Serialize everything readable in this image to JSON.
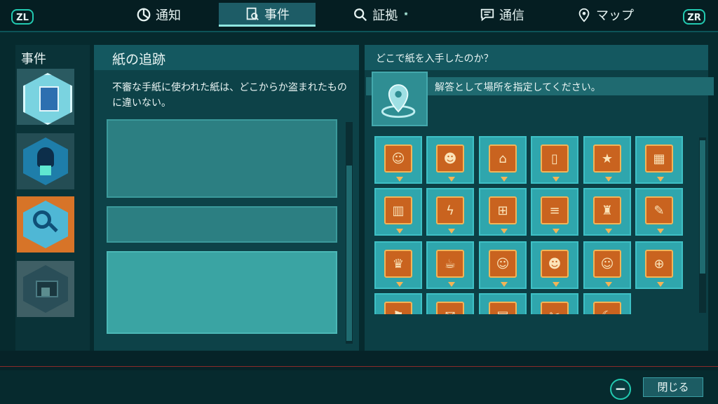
{
  "topbar": {
    "left_shoulder": "ZL",
    "right_shoulder": "ZR",
    "tabs": [
      {
        "label": "通知",
        "icon": "pie-chart-icon"
      },
      {
        "label": "事件",
        "icon": "case-file-icon"
      },
      {
        "label": "証拠",
        "icon": "magnifier-icon",
        "badge": "⁕"
      },
      {
        "label": "通信",
        "icon": "chat-icon"
      },
      {
        "label": "マップ",
        "icon": "map-pin-icon"
      }
    ]
  },
  "sidebar": {
    "title": "事件",
    "items": [
      {
        "icon": "document-icon"
      },
      {
        "icon": "hooded-figure-icon"
      },
      {
        "icon": "magnifier-paper-icon"
      },
      {
        "icon": "locked-laptop-icon"
      }
    ]
  },
  "detail": {
    "title": "紙の追跡",
    "description": "不審な手紙に使われた紙は、どこからか盗まれたものに違いない。"
  },
  "answer": {
    "question": "どこで紙を入手したのか？",
    "hint": "解答として場所を指定してください。",
    "pin_icon": "location-pin-icon",
    "options": [
      {
        "icon": "person-icon",
        "glyph": "☺"
      },
      {
        "icon": "person-icon",
        "glyph": "☻"
      },
      {
        "icon": "cap-icon",
        "glyph": "⌂"
      },
      {
        "icon": "door-icon",
        "glyph": "▯"
      },
      {
        "icon": "badge-icon",
        "glyph": "★"
      },
      {
        "icon": "building-icon",
        "glyph": "▦"
      },
      {
        "icon": "gate-icon",
        "glyph": "▥"
      },
      {
        "icon": "lightning-icon",
        "glyph": "ϟ"
      },
      {
        "icon": "network-icon",
        "glyph": "⊞"
      },
      {
        "icon": "server-icon",
        "glyph": "≡"
      },
      {
        "icon": "wine-icon",
        "glyph": "♜"
      },
      {
        "icon": "palette-icon",
        "glyph": "✎"
      },
      {
        "icon": "graduation-icon",
        "glyph": "♛"
      },
      {
        "icon": "coffee-icon",
        "glyph": "☕"
      },
      {
        "icon": "person-icon",
        "glyph": "☺"
      },
      {
        "icon": "person-icon",
        "glyph": "☻"
      },
      {
        "icon": "person-icon",
        "glyph": "☺"
      },
      {
        "icon": "globe-icon",
        "glyph": "⊕"
      },
      {
        "icon": "unknown-icon",
        "glyph": "⚑"
      },
      {
        "icon": "unknown-icon",
        "glyph": "✉"
      },
      {
        "icon": "unknown-icon",
        "glyph": "▤"
      },
      {
        "icon": "unknown-icon",
        "glyph": "✂"
      },
      {
        "icon": "unknown-icon",
        "glyph": "☾"
      }
    ]
  },
  "footer": {
    "minus_label": "−",
    "close_label": "閉じる"
  }
}
